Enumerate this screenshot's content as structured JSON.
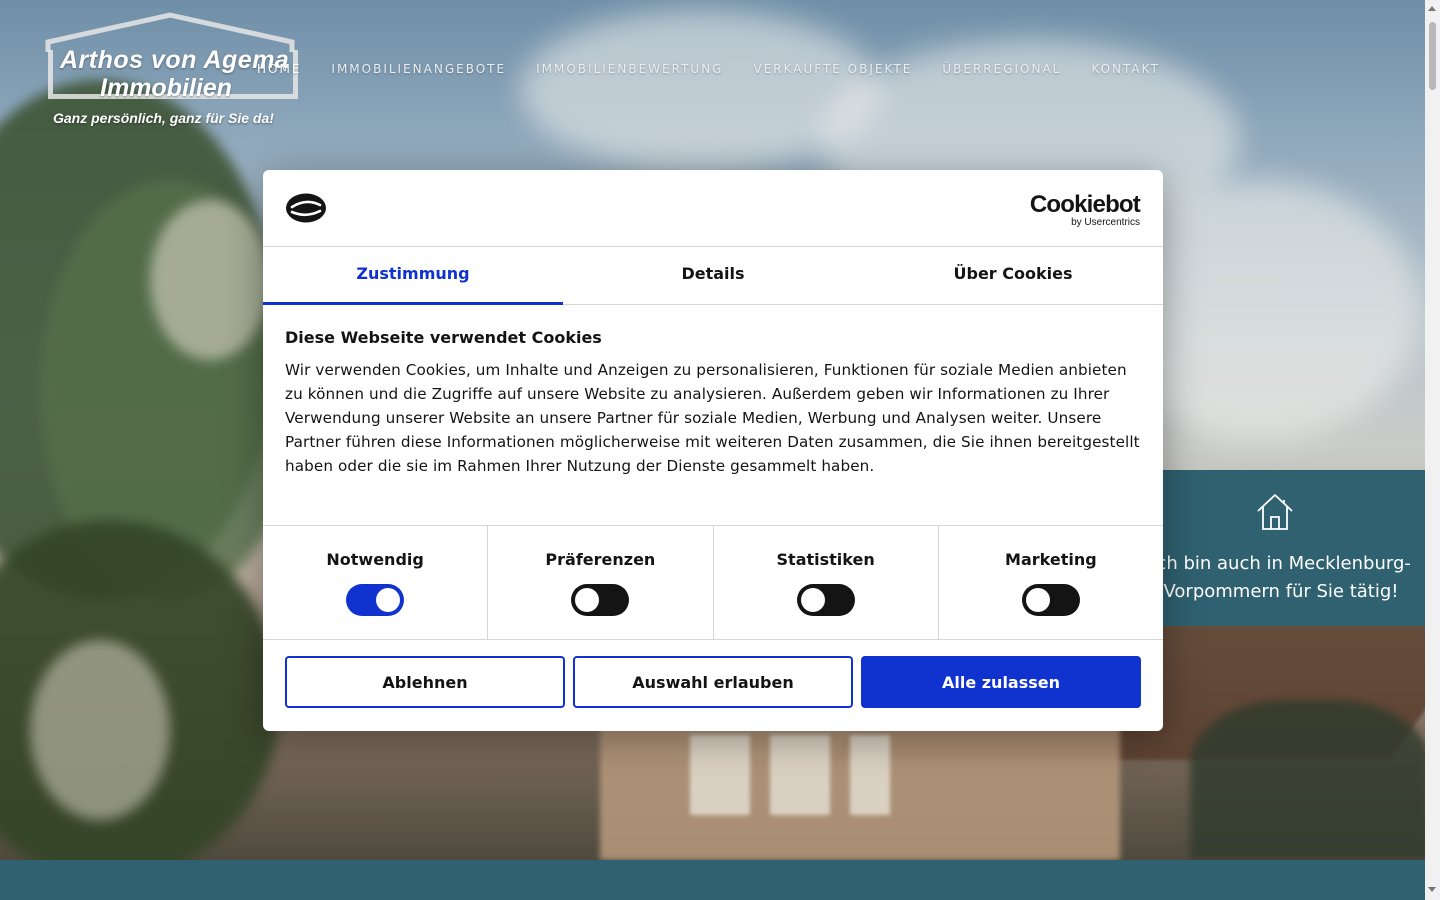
{
  "logo": {
    "line1": "Arthos von Agema",
    "line2": "Immobilien",
    "tagline": "Ganz persönlich, ganz für Sie da!"
  },
  "nav": {
    "items": [
      {
        "label": "HOME",
        "active": true
      },
      {
        "label": "IMMOBILIENANGEBOTE",
        "active": false
      },
      {
        "label": "IMMOBILIENBEWERTUNG",
        "active": false
      },
      {
        "label": "VERKAUFTE OBJEKTE",
        "active": false
      },
      {
        "label": "ÜBERREGIONAL",
        "active": false
      },
      {
        "label": "KONTAKT",
        "active": false
      }
    ]
  },
  "promo": {
    "icon": "house-icon",
    "text": "Ich bin auch in Mecklenburg-Vorpommern für Sie tätig!"
  },
  "cookie_dialog": {
    "brand": {
      "name": "Cookiebot",
      "sub": "by Usercentrics"
    },
    "tabs": [
      {
        "label": "Zustimmung",
        "active": true
      },
      {
        "label": "Details",
        "active": false
      },
      {
        "label": "Über Cookies",
        "active": false
      }
    ],
    "title": "Diese Webseite verwendet Cookies",
    "body": "Wir verwenden Cookies, um Inhalte und Anzeigen zu personalisieren, Funktionen für soziale Medien anbieten zu können und die Zugriffe auf unsere Website zu analysieren. Außerdem geben wir Informationen zu Ihrer Verwendung unserer Website an unsere Partner für soziale Medien, Werbung und Analysen weiter. Unsere Partner führen diese Informationen möglicherweise mit weiteren Daten zusammen, die Sie ihnen bereitgestellt haben oder die sie im Rahmen Ihrer Nutzung der Dienste gesammelt haben.",
    "toggles": [
      {
        "label": "Notwendig",
        "on": true
      },
      {
        "label": "Präferenzen",
        "on": false
      },
      {
        "label": "Statistiken",
        "on": false
      },
      {
        "label": "Marketing",
        "on": false
      }
    ],
    "buttons": {
      "decline": "Ablehnen",
      "allow_selection": "Auswahl erlauben",
      "allow_all": "Alle zulassen"
    }
  },
  "colors": {
    "accent": "#1032cf",
    "teal": "#2f6170"
  }
}
